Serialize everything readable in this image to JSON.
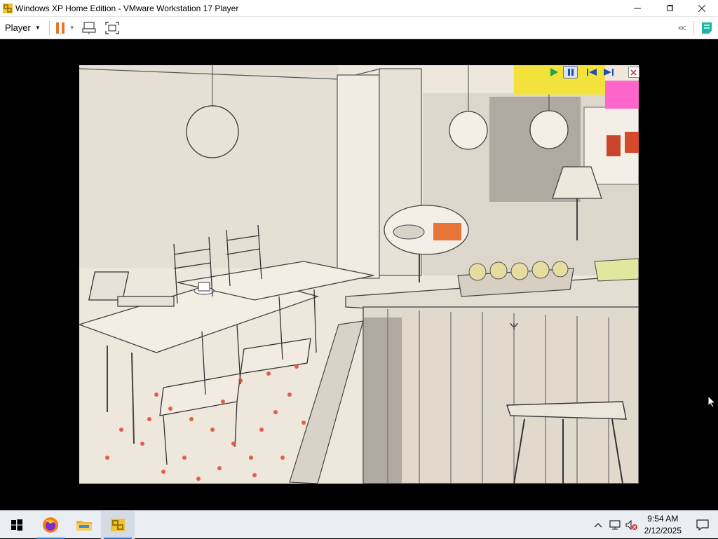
{
  "window": {
    "title": "Windows XP Home Edition - VMware Workstation 17 Player",
    "icon": "vmware-player-icon",
    "controls": [
      "minimize-icon",
      "maximize-icon",
      "close-icon"
    ]
  },
  "toolbar": {
    "player_label": "Player",
    "icons": [
      "pause-icon",
      "send-ctrl-alt-del-icon",
      "fullscreen-icon",
      "collapse-chevron-icon",
      "notes-icon"
    ],
    "collapse_glyph": "<<"
  },
  "guest": {
    "description_icon": "cafe-sketch-wallpaper",
    "media_controls": [
      "play-icon",
      "pause-icon",
      "previous-icon",
      "next-icon",
      "close-icon"
    ]
  },
  "taskbar": {
    "pinned": [
      {
        "name": "start-button",
        "icon": "windows-logo-icon"
      },
      {
        "name": "firefox-taskbar-button",
        "icon": "firefox-icon"
      },
      {
        "name": "file-explorer-taskbar-button",
        "icon": "folder-icon"
      },
      {
        "name": "vmware-taskbar-button",
        "icon": "vmware-player-icon",
        "active": true
      }
    ],
    "tray_icons": [
      "chevron-up-icon",
      "network-icon",
      "volume-muted-icon"
    ],
    "clock": {
      "time": "9:54 AM",
      "date": "2/12/2025"
    },
    "notification_icon": "action-center-icon"
  },
  "colors": {
    "accent": "#2a7ad6",
    "pause_orange": "#e8742a",
    "sketch_bg": "#efe8de",
    "petal_red": "#e2472f",
    "pink_note": "#ff66cc",
    "yellow_ruler": "#f3e23b"
  }
}
